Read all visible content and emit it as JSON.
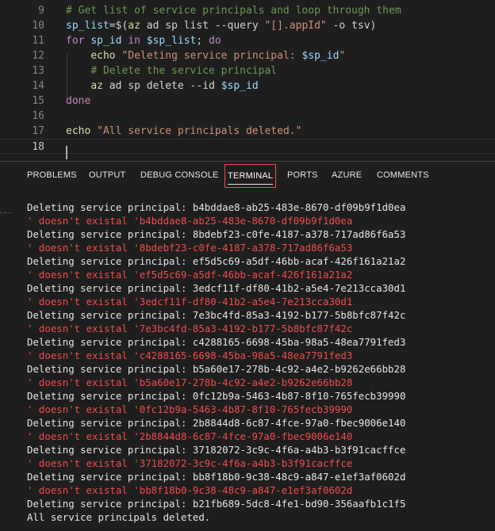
{
  "editor": {
    "lines": [
      {
        "num": "9",
        "tokens": [
          {
            "t": "# Get list of service principals and loop through them",
            "c": "comment"
          }
        ]
      },
      {
        "num": "10",
        "tokens": [
          {
            "t": "sp_list",
            "c": "var"
          },
          {
            "t": "=$(",
            "c": "plain"
          },
          {
            "t": "az",
            "c": "func"
          },
          {
            "t": " ad sp list --query ",
            "c": "plain"
          },
          {
            "t": "\"[].appId\"",
            "c": "string"
          },
          {
            "t": " -o tsv)",
            "c": "plain"
          }
        ]
      },
      {
        "num": "11",
        "tokens": [
          {
            "t": "for",
            "c": "keyword"
          },
          {
            "t": " ",
            "c": "plain"
          },
          {
            "t": "sp_id",
            "c": "var"
          },
          {
            "t": " ",
            "c": "plain"
          },
          {
            "t": "in",
            "c": "keyword"
          },
          {
            "t": " ",
            "c": "plain"
          },
          {
            "t": "$sp_list",
            "c": "var"
          },
          {
            "t": "; ",
            "c": "plain"
          },
          {
            "t": "do",
            "c": "keyword"
          }
        ]
      },
      {
        "num": "12",
        "tokens": [
          {
            "t": "    ",
            "c": "plain"
          },
          {
            "t": "echo",
            "c": "func"
          },
          {
            "t": " ",
            "c": "plain"
          },
          {
            "t": "\"Deleting service principal: ",
            "c": "string"
          },
          {
            "t": "$sp_id",
            "c": "var"
          },
          {
            "t": "\"",
            "c": "string"
          }
        ]
      },
      {
        "num": "13",
        "tokens": [
          {
            "t": "    ",
            "c": "plain"
          },
          {
            "t": "# Delete the service principal",
            "c": "comment"
          }
        ]
      },
      {
        "num": "14",
        "tokens": [
          {
            "t": "    ",
            "c": "plain"
          },
          {
            "t": "az",
            "c": "func"
          },
          {
            "t": " ad sp delete --id ",
            "c": "plain"
          },
          {
            "t": "$sp_id",
            "c": "var"
          }
        ]
      },
      {
        "num": "15",
        "tokens": [
          {
            "t": "done",
            "c": "keyword"
          }
        ]
      },
      {
        "num": "16",
        "tokens": []
      },
      {
        "num": "17",
        "tokens": [
          {
            "t": "echo",
            "c": "func"
          },
          {
            "t": " ",
            "c": "plain"
          },
          {
            "t": "\"All service principals deleted.\"",
            "c": "string"
          }
        ]
      },
      {
        "num": "18",
        "tokens": [],
        "current": true
      }
    ]
  },
  "panel": {
    "tabs": [
      {
        "id": "problems",
        "label": "PROBLEMS"
      },
      {
        "id": "output",
        "label": "OUTPUT"
      },
      {
        "id": "debug-console",
        "label": "DEBUG CONSOLE"
      },
      {
        "id": "terminal",
        "label": "TERMINAL",
        "active": true
      },
      {
        "id": "ports",
        "label": "PORTS"
      },
      {
        "id": "azure",
        "label": "AZURE"
      },
      {
        "id": "comments",
        "label": "COMMENTS"
      }
    ]
  },
  "terminal": {
    "lines": [
      {
        "text": "Deleting service principal: b4bddae8-ab25-483e-8670-df09b9f1d0ea",
        "kind": "out"
      },
      {
        "text": "' doesn't existal 'b4bddae8-ab25-483e-8670-df09b9f1d0ea",
        "kind": "err"
      },
      {
        "text": "Deleting service principal: 8bdebf23-c0fe-4187-a378-717ad86f6a53",
        "kind": "out"
      },
      {
        "text": "' doesn't existal '8bdebf23-c0fe-4187-a378-717ad86f6a53",
        "kind": "err"
      },
      {
        "text": "Deleting service principal: ef5d5c69-a5df-46bb-acaf-426f161a21a2",
        "kind": "out"
      },
      {
        "text": "' doesn't existal 'ef5d5c69-a5df-46bb-acaf-426f161a21a2",
        "kind": "err"
      },
      {
        "text": "Deleting service principal: 3edcf11f-df80-41b2-a5e4-7e213cca30d1",
        "kind": "out"
      },
      {
        "text": "' doesn't existal '3edcf11f-df80-41b2-a5e4-7e213cca30d1",
        "kind": "err"
      },
      {
        "text": "Deleting service principal: 7e3bc4fd-85a3-4192-b177-5b8bfc87f42c",
        "kind": "out"
      },
      {
        "text": "' doesn't existal '7e3bc4fd-85a3-4192-b177-5b8bfc87f42c",
        "kind": "err"
      },
      {
        "text": "Deleting service principal: c4288165-6698-45ba-98a5-48ea7791fed3",
        "kind": "out"
      },
      {
        "text": "' doesn't existal 'c4288165-6698-45ba-98a5-48ea7791fed3",
        "kind": "err"
      },
      {
        "text": "Deleting service principal: b5a60e17-278b-4c92-a4e2-b9262e66bb28",
        "kind": "out"
      },
      {
        "text": "' doesn't existal 'b5a60e17-278b-4c92-a4e2-b9262e66bb28",
        "kind": "err"
      },
      {
        "text": "Deleting service principal: 0fc12b9a-5463-4b87-8f10-765fecb39990",
        "kind": "out"
      },
      {
        "text": "' doesn't existal '0fc12b9a-5463-4b87-8f10-765fecb39990",
        "kind": "err"
      },
      {
        "text": "Deleting service principal: 2b8844d8-6c87-4fce-97a0-fbec9006e140",
        "kind": "out"
      },
      {
        "text": "' doesn't existal '2b8844d8-6c87-4fce-97a0-fbec9006e140",
        "kind": "err"
      },
      {
        "text": "Deleting service principal: 37182072-3c9c-4f6a-a4b3-b3f91cacffce",
        "kind": "out"
      },
      {
        "text": "' doesn't existal '37182072-3c9c-4f6a-a4b3-b3f91cacffce",
        "kind": "err"
      },
      {
        "text": "Deleting service principal: bb8f18b0-9c38-48c9-a847-e1ef3af0602d",
        "kind": "out"
      },
      {
        "text": "' doesn't existal 'bb8f18b0-9c38-48c9-a847-e1ef3af0602d",
        "kind": "err"
      },
      {
        "text": "Deleting service principal: b21fb689-5dc8-4fe1-bd90-356aafb1c1f5",
        "kind": "out"
      },
      {
        "text": "All service principals deleted.",
        "kind": "out"
      }
    ]
  }
}
